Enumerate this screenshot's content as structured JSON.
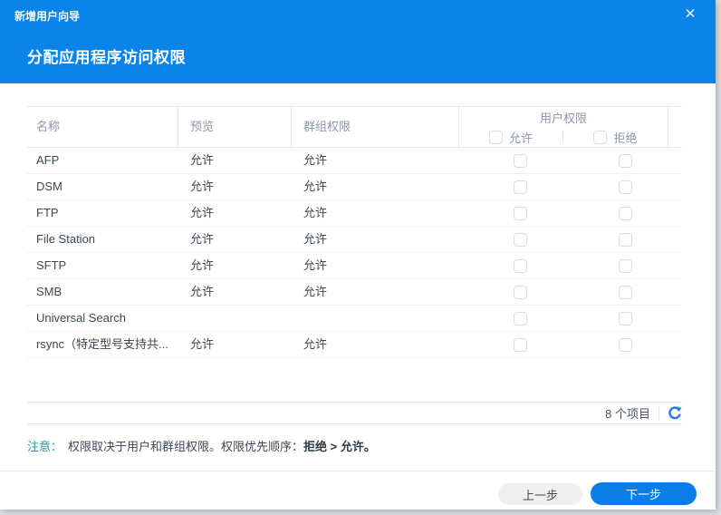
{
  "window": {
    "title": "新增用户向导",
    "close_icon": "✕"
  },
  "header": {
    "step_title": "分配应用程序访问权限"
  },
  "table": {
    "columns": {
      "name": "名称",
      "preview": "预览",
      "group_perm": "群组权限",
      "user_perm": "用户权限",
      "allow": "允许",
      "deny": "拒绝"
    },
    "rows": [
      {
        "name": "AFP",
        "preview": "允许",
        "group": "允许"
      },
      {
        "name": "DSM",
        "preview": "允许",
        "group": "允许"
      },
      {
        "name": "FTP",
        "preview": "允许",
        "group": "允许"
      },
      {
        "name": "File Station",
        "preview": "允许",
        "group": "允许"
      },
      {
        "name": "SFTP",
        "preview": "允许",
        "group": "允许"
      },
      {
        "name": "SMB",
        "preview": "允许",
        "group": "允许"
      },
      {
        "name": "Universal Search",
        "preview": "",
        "group": ""
      },
      {
        "name": "rsync（特定型号支持共...",
        "preview": "允许",
        "group": "允许"
      }
    ],
    "footer": {
      "count_label": "8 个项目",
      "refresh_icon": "circular-arrow-refresh"
    }
  },
  "note": {
    "label": "注意：",
    "text": "权限取决于用户和群组权限。权限优先顺序：",
    "bold_deny": "拒绝",
    "separator": " > ",
    "bold_allow": "允许。"
  },
  "buttons": {
    "back": "上一步",
    "next": "下一步"
  },
  "colors": {
    "titlebar": "#0a84e8",
    "next_button": "#0b7de6",
    "back_button_bg": "#eef0f2",
    "note_label": "#17a2a2",
    "refresh_icon": "#2a7de0"
  }
}
